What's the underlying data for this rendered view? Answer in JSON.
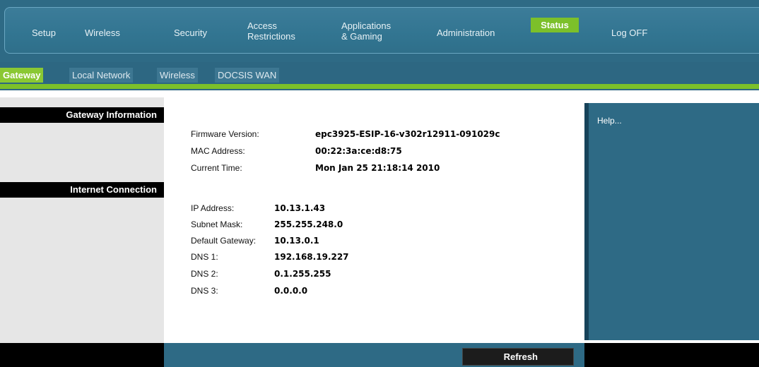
{
  "nav": {
    "setup": "Setup",
    "wireless": "Wireless",
    "security": "Security",
    "access_line1": "Access",
    "access_line2": "Restrictions",
    "apps_line1": "Applications",
    "apps_line2": "& Gaming",
    "administration": "Administration",
    "status": "Status",
    "logoff": "Log OFF"
  },
  "tabs": [
    "Gateway",
    "Local Network",
    "Wireless",
    "DOCSIS WAN"
  ],
  "sections": {
    "gateway_info": "Gateway Information",
    "internet_connection": "Internet Connection"
  },
  "gateway": {
    "firmware_label": "Firmware Version:",
    "firmware_value": "epc3925-ESIP-16-v302r12911-091029c",
    "mac_label": "MAC Address:",
    "mac_value": "00:22:3a:ce:d8:75",
    "time_label": "Current Time:",
    "time_value": "Mon Jan 25 21:18:14 2010"
  },
  "internet": {
    "ip_label": "IP Address:",
    "ip_value": "10.13.1.43",
    "subnet_label": "Subnet Mask:",
    "subnet_value": "255.255.248.0",
    "gateway_label": "Default Gateway:",
    "gateway_value": "10.13.0.1",
    "dns1_label": "DNS 1:",
    "dns1_value": "192.168.19.227",
    "dns2_label": "DNS 2:",
    "dns2_value": "0.1.255.255",
    "dns3_label": "DNS 3:",
    "dns3_value": "0.0.0.0"
  },
  "help": "Help...",
  "refresh": "Refresh",
  "colors": {
    "nav_blue": "#2e6a85",
    "accent_green": "#7cc02a",
    "black_bar": "#000000"
  }
}
